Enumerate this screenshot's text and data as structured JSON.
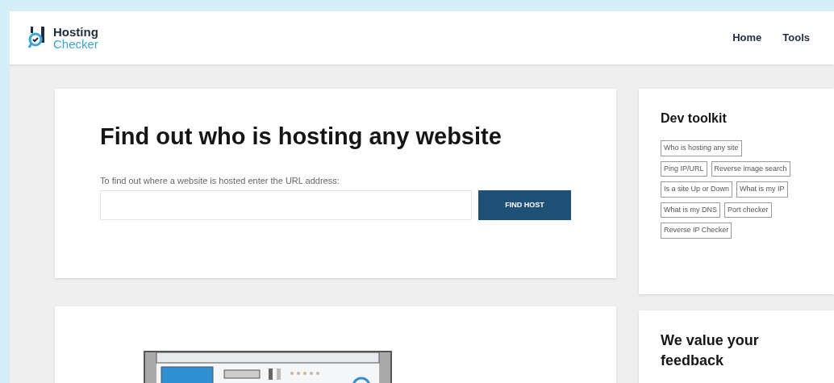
{
  "logo": {
    "line_1": "Hosting",
    "line_2": "Checker"
  },
  "nav": [
    "Home",
    "Tools"
  ],
  "search_card": {
    "title": "Find out who is hosting any website",
    "label": "To find out where a website is hosted enter the URL address:",
    "button": "FIND HOST"
  },
  "dev_toolkit": {
    "title": "Dev toolkit",
    "links": [
      [
        "Who is hosting any site"
      ],
      [
        "Ping IP/URL",
        "Reverse image search"
      ],
      [
        "Is a site Up or Down",
        "What is my IP"
      ],
      [
        "What is my DNS",
        "Port checker"
      ],
      [
        "Reverse IP Checker"
      ]
    ]
  },
  "feedback": {
    "title": "We value your feedback"
  }
}
